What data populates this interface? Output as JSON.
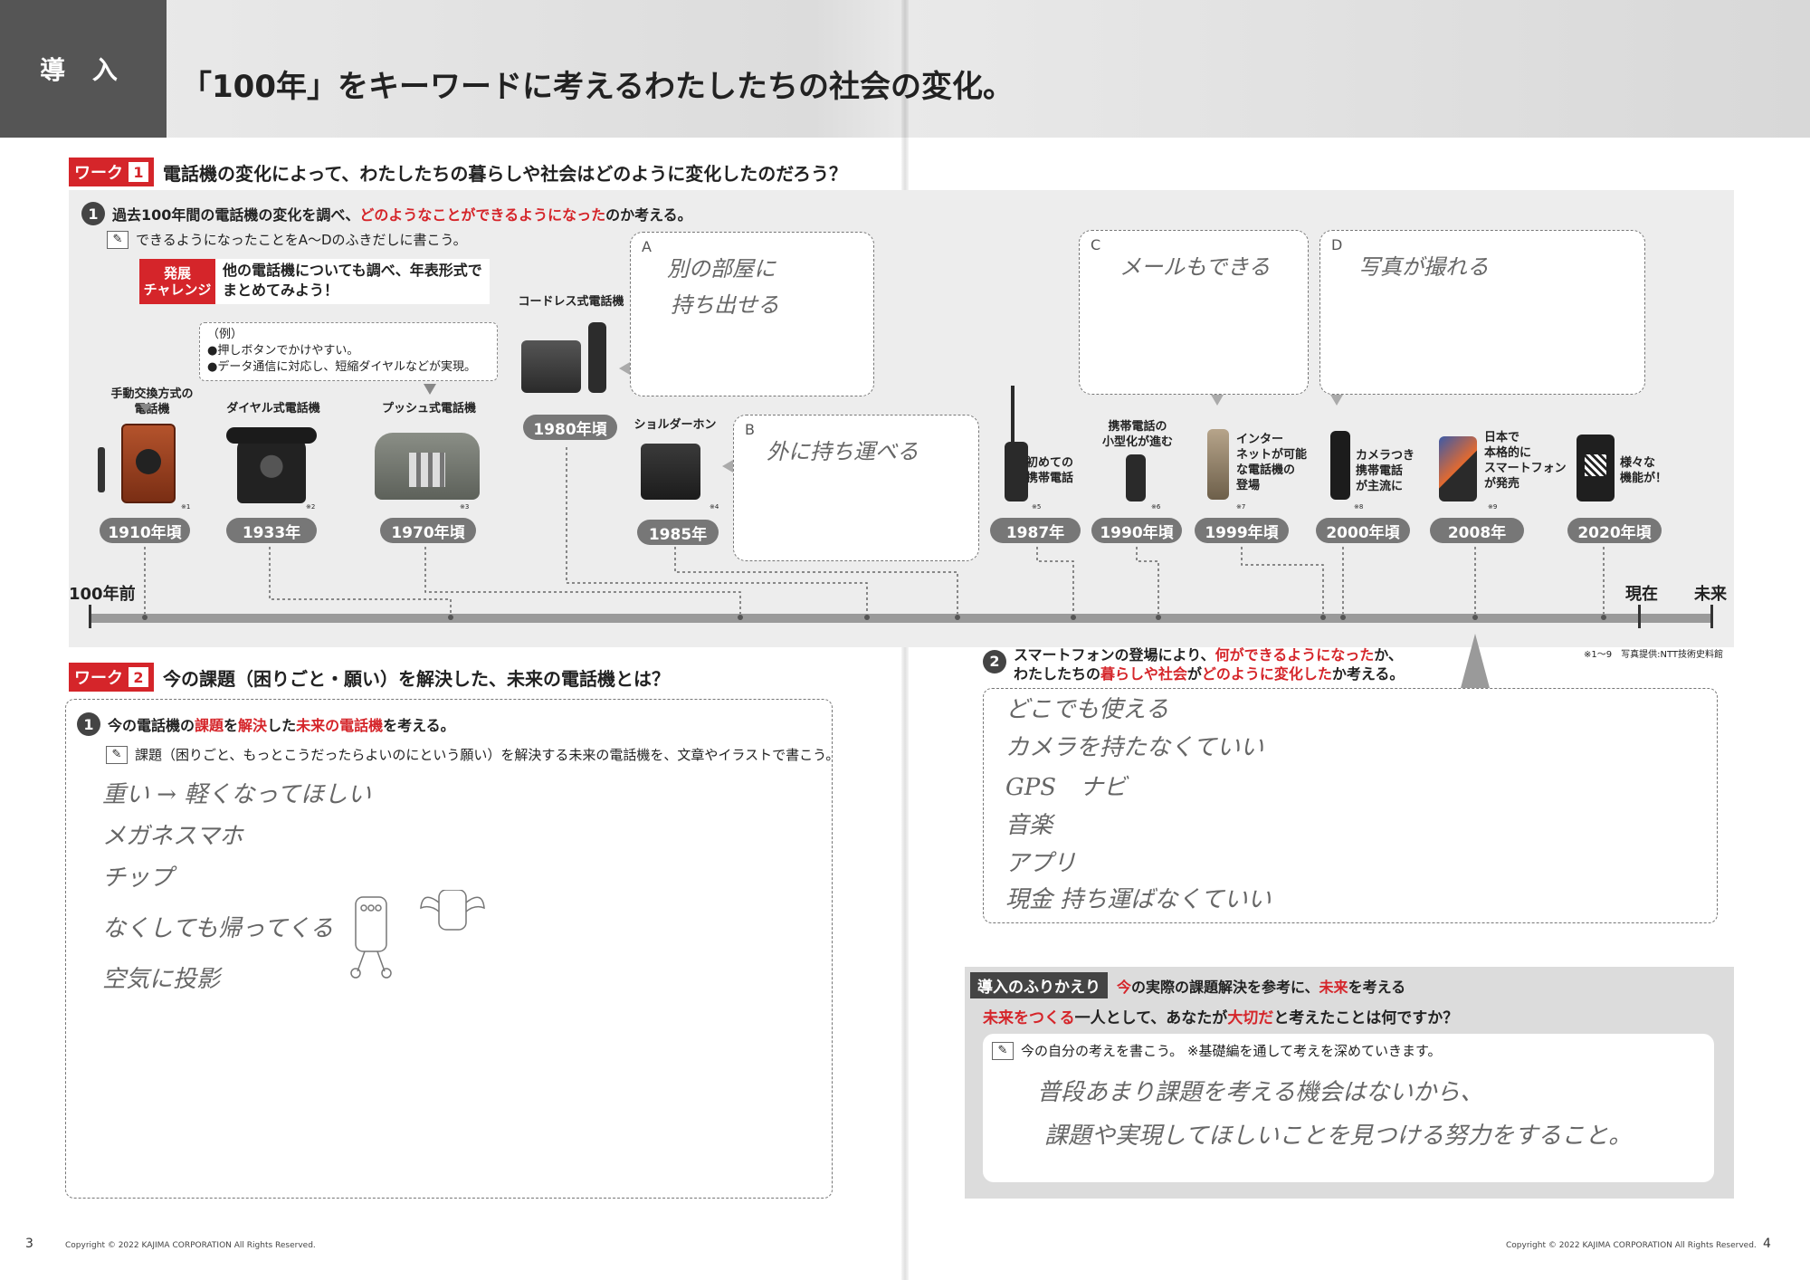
{
  "header": {
    "tag": "導 入",
    "title": "「100年」をキーワードに考えるわたしたちの社会の変化。"
  },
  "work1": {
    "badge": "ワーク",
    "num": "1",
    "question": "電話機の変化によって、わたしたちの暮らしや社会はどのように変化したのだろう？",
    "step1": {
      "num": "1",
      "text_a": "過去100年間の電話機の変化を調べ、",
      "text_red": "どのようなことができるようになった",
      "text_b": "のか考える。"
    },
    "instruction": "できるようになったことをA〜Dのふきだしに書こう。",
    "challenge": {
      "label_l1": "発展",
      "label_l2": "チャレンジ",
      "text_l1": "他の電話機についても調べ、年表形式で",
      "text_l2": "まとめてみよう！"
    },
    "example": {
      "head": "（例）",
      "l1": "●押しボタンでかけやすい。",
      "l2": "●データ通信に対応し、短縮ダイヤルなどが実現。"
    },
    "bubbles": {
      "a": {
        "letter": "A",
        "l1": "別の部屋に",
        "l2": "持ち出せる"
      },
      "b": {
        "letter": "B",
        "l1": "外に持ち運べる"
      },
      "c": {
        "letter": "C",
        "l1": "メールもできる"
      },
      "d": {
        "letter": "D",
        "l1": "写真が撮れる"
      }
    },
    "phones": {
      "p1910": {
        "label_l1": "手動交換方式の",
        "label_l2": "電話機",
        "year": "1910年頃",
        "note": "※1"
      },
      "p1933": {
        "label_l1": "ダイヤル式電話機",
        "year": "1933年",
        "note": "※2"
      },
      "p1970": {
        "label_l1": "プッシュ式電話機",
        "year": "1970年頃",
        "note": "※3"
      },
      "p1980": {
        "label_l1": "コードレス式電話機",
        "year": "1980年頃"
      },
      "p1985": {
        "label_l1": "ショルダーホン",
        "year": "1985年",
        "note": "※4"
      },
      "p1987": {
        "label_l1": "初めての",
        "label_l2": "携帯電話",
        "year": "1987年",
        "note": "※5"
      },
      "p1990": {
        "label_l1": "携帯電話の",
        "label_l2": "小型化が進む",
        "year": "1990年頃",
        "note": "※6"
      },
      "p1999": {
        "label_l1": "インター",
        "label_l2": "ネットが可能",
        "label_l3": "な電話機の",
        "label_l4": "登場",
        "year": "1999年頃",
        "note": "※7"
      },
      "p2000": {
        "label_l1": "カメラつき",
        "label_l2": "携帯電話",
        "label_l3": "が主流に",
        "year": "2000年頃",
        "note": "※8"
      },
      "p2008": {
        "label_l1": "日本で",
        "label_l2": "本格的に",
        "label_l3": "スマートフォン",
        "label_l4": "が発売",
        "year": "2008年",
        "note": "※9"
      },
      "p2020": {
        "label_l1": "様々な",
        "label_l2": "機能が！",
        "year": "2020年頃"
      }
    },
    "axis": {
      "start": "100年前",
      "now": "現在",
      "future": "未来"
    },
    "credit": "※1〜9　写真提供:NTT技術史料館",
    "step2": {
      "num": "2",
      "l1_a": "スマートフォンの登場により、",
      "l1_red": "何ができるようになった",
      "l1_b": "か、",
      "l2_a": "わたしたちの",
      "l2_red1": "暮らしや社会",
      "l2_b": "が",
      "l2_red2": "どのように変化した",
      "l2_c": "か考える。"
    },
    "step2_answers": [
      "どこでも使える",
      "カメラを持たなくていい",
      "GPS　ナビ",
      "音楽",
      "アプリ",
      "現金 持ち運ばなくていい"
    ]
  },
  "work2": {
    "badge": "ワーク",
    "num": "2",
    "question": "今の課題（困りごと・願い）を解決した、未来の電話機とは？",
    "step1": {
      "num": "1",
      "t1": "今の電話機の",
      "r1": "課題",
      "t2": "を",
      "r2": "解決",
      "t3": "した",
      "r3": "未来の電話機",
      "t4": "を考える。"
    },
    "instruction": "課題（困りごと、もっとこうだったらよいのにという願い）を解決する未来の電話機を、文章やイラストで書こう。",
    "answers": [
      "重い → 軽くなってほしい",
      "メガネスマホ",
      "チップ",
      "なくしても帰ってくる",
      "空気に投影"
    ]
  },
  "reflection": {
    "head": "導入のふりかえり",
    "sub_a": "今",
    "sub_b": "の実際の課題解決を参考に、",
    "sub_red": "未来",
    "sub_c": "を考える",
    "q_red1": "未来をつくる",
    "q_a": "一人として、あなたが",
    "q_red2": "大切だ",
    "q_b": "と考えたことは何ですか？",
    "instruction": "今の自分の考えを書こう。 ※基礎編を通して考えを深めていきます。",
    "answer_l1": "普段あまり課題を考える機会はないから、",
    "answer_l2": "課題や実現してほしいことを見つける努力をすること。"
  },
  "footer": {
    "left_page": "3",
    "right_page": "4",
    "copyright": "Copyright © 2022 KAJIMA CORPORATION All Rights Reserved."
  },
  "colors": {
    "accent": "#d5252a",
    "dark": "#444444",
    "panel": "#ededed"
  }
}
